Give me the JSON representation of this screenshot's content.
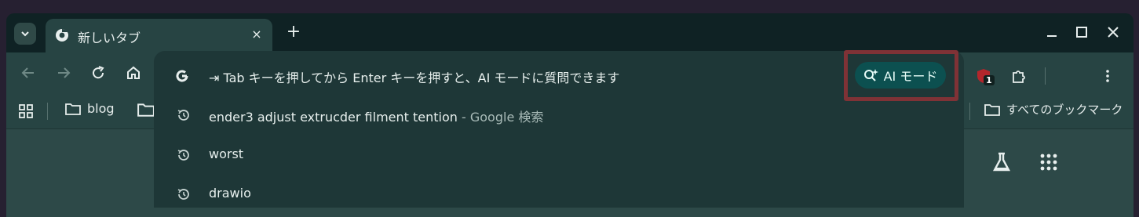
{
  "browser": {
    "tab": {
      "title": "新しいタブ",
      "close_glyph": "×"
    },
    "new_tab_glyph": "+"
  },
  "omnibox": {
    "hint_prefix": "⇥ Tab キーを押してから Enter キーを押すと、AI モードに質問できます",
    "ai_mode_label": "AI モード",
    "suggestions": [
      {
        "text": "ender3 adjust extrucder filment tention",
        "suffix": " - Google 検索"
      },
      {
        "text": "worst",
        "suffix": ""
      },
      {
        "text": "drawio",
        "suffix": ""
      }
    ]
  },
  "bookmarks": {
    "items": [
      {
        "label": "blog"
      }
    ],
    "all_bookmarks_label": "すべてのブックマーク"
  },
  "extensions": {
    "badge_count": "1"
  },
  "colors": {
    "accent": "#0c5050",
    "highlight_box": "#7f3236",
    "window_bg": "#0f2224",
    "toolbar_bg": "#274443"
  }
}
